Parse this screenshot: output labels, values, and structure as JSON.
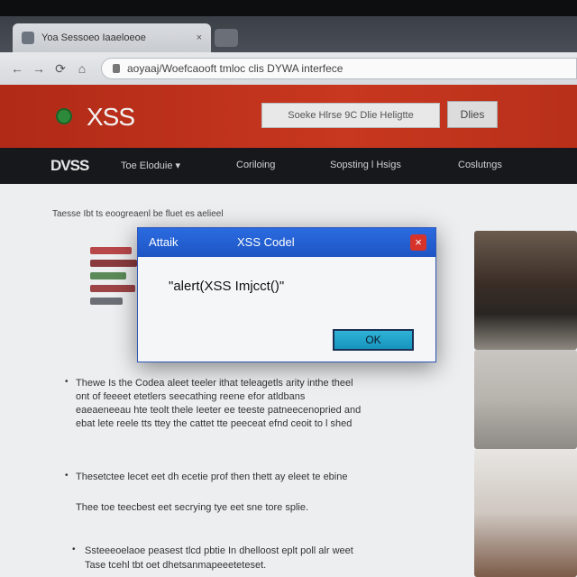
{
  "browser": {
    "tab_title": "Yoa Sessoeo Iaaeloeoe",
    "tab_close": "×",
    "url": "aoyaaj/Woefcaooft tmloc clis DYWA interfece",
    "nav": {
      "back": "←",
      "forward": "→",
      "reload": "⟳",
      "home": "⌂"
    }
  },
  "header": {
    "logo": "XSS",
    "search_text": "Soeke Hlrse 9C Dlie Heligtte",
    "search_button": "Dlies"
  },
  "navbar": {
    "brand": "DVSS",
    "items": [
      {
        "label": "Toe Eloduie ▾"
      },
      {
        "label": "Coriloing"
      },
      {
        "label": "Sopsting l Hsigs"
      },
      {
        "label": "Coslutngs"
      }
    ]
  },
  "content": {
    "intro": "Taesse Ibt ts eoogreaenl be fluet es aelieel",
    "paragraphs": [
      "Thewe Is the Codea aleet teeler ithat teleagetls arity inthe theel",
      "ont of feeeet etetlers seecathing reene efor atldbans",
      "eaeaeneeau hte teolt thele Ieeter ee teeste patneecenopried and",
      "ebat lete reele tts ttey the cattet tte peeceat efnd ceoit to l shed",
      "Thesetctee lecet eet dh ecetie prof then thett ay eleet te ebine",
      "Thee toe teecbest eet secrying tye eet sne tore splie.",
      "Ssteeeoelaoe peasest tlcd pbtie In dhelloost eplt poll alr weet",
      "Tase tcehl tbt oet dhetsanmapeeeteteset."
    ],
    "bullets": [
      "•",
      "•",
      "•"
    ]
  },
  "dialog": {
    "title_left": "Attaik",
    "title_center": "XSS Codel",
    "close": "×",
    "message": "\"alert(XSS Imjcct()\"",
    "ok": "OK"
  },
  "colors": {
    "header_red": "#c8371f",
    "navbar_dark": "#16181c",
    "dialog_title": "#2a6be0",
    "ok_button": "#1693bd",
    "close_red": "#d6332a"
  }
}
